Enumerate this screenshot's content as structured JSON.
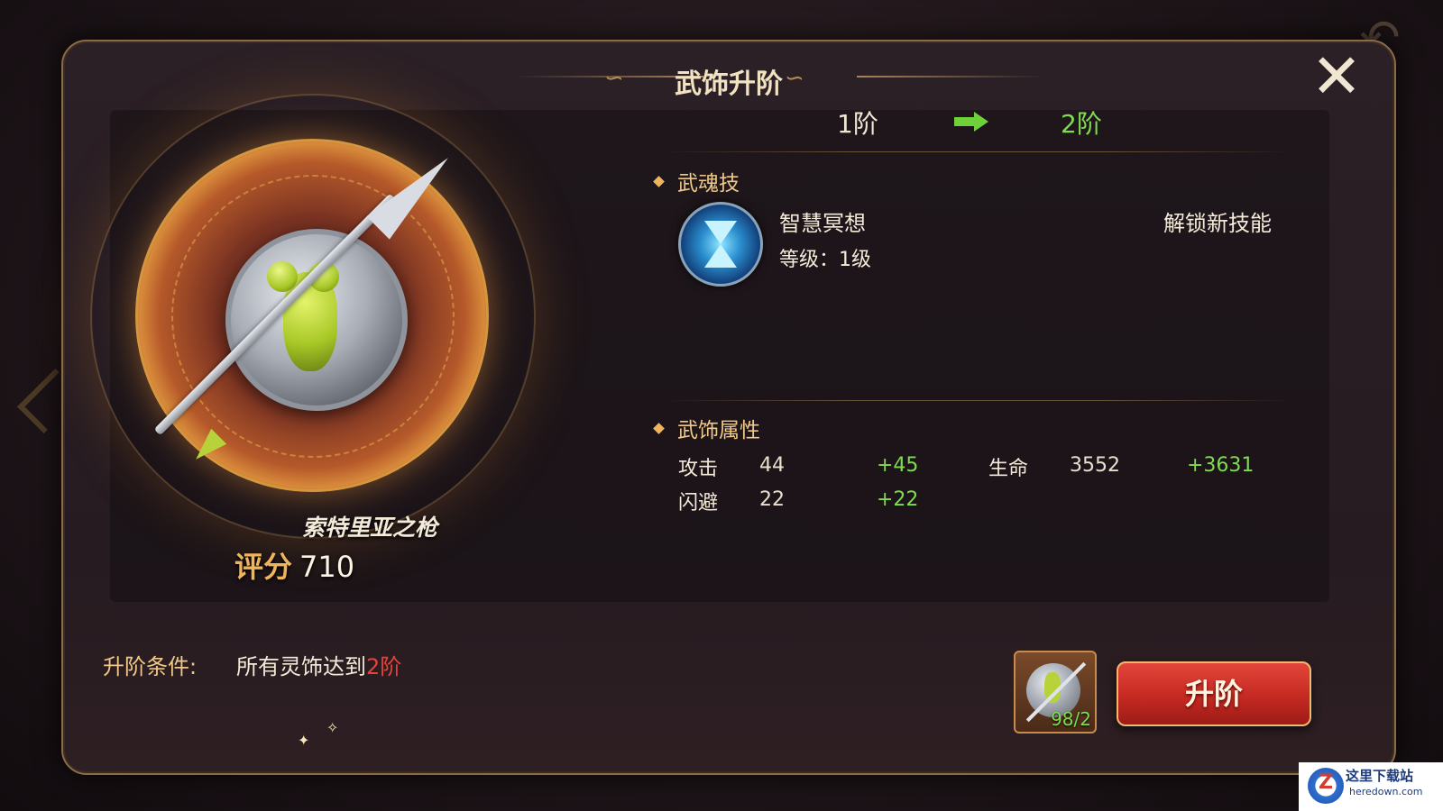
{
  "dialog": {
    "title": "武饰升阶",
    "close_icon": "close-icon"
  },
  "weapon": {
    "name": "索特里亚之枪",
    "score_label": "评分",
    "score_value": "710"
  },
  "tier": {
    "from": "1阶",
    "to": "2阶"
  },
  "skill_section": {
    "heading": "武魂技",
    "skill_name": "智慧冥想",
    "skill_level": "等级：1级",
    "unlock_text": "解锁新技能",
    "icon": "hourglass-icon"
  },
  "attr_section": {
    "heading": "武饰属性",
    "stats": [
      {
        "label": "攻击",
        "value": "44",
        "gain": "+45"
      },
      {
        "label": "生命",
        "value": "3552",
        "gain": "+3631"
      },
      {
        "label": "闪避",
        "value": "22",
        "gain": "+22"
      }
    ]
  },
  "condition": {
    "label": "升阶条件:",
    "text": "所有灵饰达到",
    "highlight": "2阶"
  },
  "material": {
    "count": "98/2"
  },
  "upgrade_button": "升阶",
  "watermark": {
    "cn": "这里下载站",
    "en": "heredown.com",
    "logo": "Z"
  },
  "colors": {
    "accent_gold": "#f0b45a",
    "gain_green": "#7fdc4e",
    "highlight_red": "#e8413a",
    "button_red": "#c52a22"
  }
}
